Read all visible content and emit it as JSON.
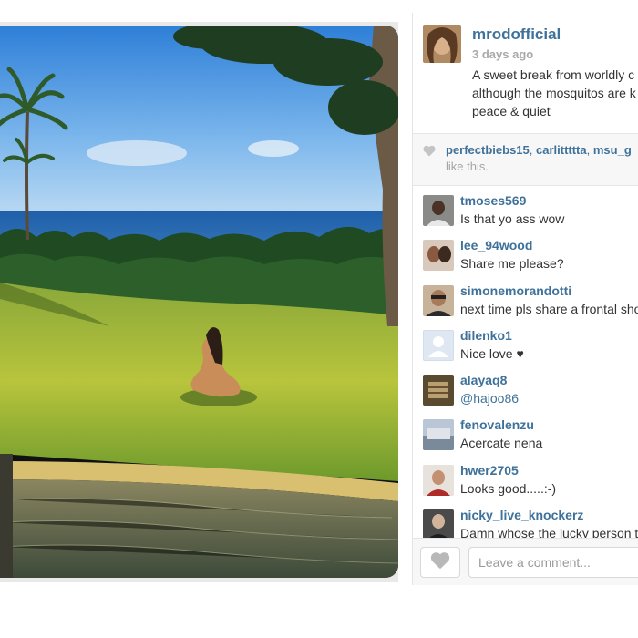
{
  "post": {
    "username": "mrodofficial",
    "time_ago": "3 days ago",
    "caption_lines": [
      "A sweet break from worldly c",
      "although the mosquitos are k",
      "peace & quiet"
    ]
  },
  "likes": {
    "names": [
      "perfectbiebs15",
      "carlittttta",
      "msu_g"
    ],
    "suffix": "like this."
  },
  "comments": [
    {
      "user": "tmoses569",
      "text": "Is that yo ass wow",
      "avatar_color": "#6b5a4c"
    },
    {
      "user": "lee_94wood",
      "text": "Share me please?",
      "avatar_color": "#8a6f5e"
    },
    {
      "user": "simonemorandotti",
      "text": "next time pls share a frontal sho",
      "avatar_color": "#9a7a63"
    },
    {
      "user": "dilenko1",
      "text": "Nice love ♥",
      "avatar_color": "#dfe7f2"
    },
    {
      "user": "alayaq8",
      "text": "@hajoo86",
      "avatar_color": "#6e5a3b",
      "is_mention": true
    },
    {
      "user": "fenovalenzu",
      "text": "Acercate nena",
      "avatar_color": "#8aa0b8"
    },
    {
      "user": "hwer2705",
      "text": "Looks good.....:-)",
      "avatar_color": "#b98f7a"
    },
    {
      "user": "nicky_live_knockerz",
      "text": "Damn whose the lucky person t",
      "avatar_color": "#5a5a5a"
    }
  ],
  "comment_box": {
    "placeholder": "Leave a comment..."
  },
  "colors": {
    "link": "#3f729b",
    "muted": "#a9a9a9",
    "panel_bg": "#f7f7f7"
  },
  "icons": {
    "like": "heart-icon",
    "default_avatar": "person-silhouette-icon"
  }
}
